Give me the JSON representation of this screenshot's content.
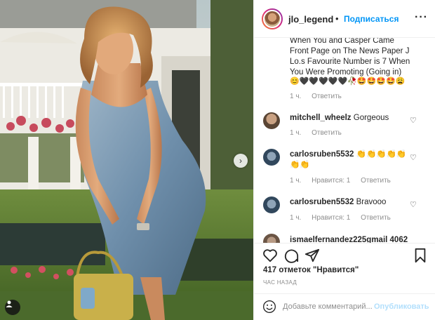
{
  "header": {
    "username": "jlo_legend",
    "separator": "•",
    "follow_label": "Подписаться",
    "more_icon": "ellipsis-icon"
  },
  "comments": {
    "first": {
      "lines": [
        "When You and Casper Came",
        "Front Page on The News Paper J",
        "Lo.s Favourite Number is 7 When",
        "You Were Promoting (Going in)"
      ],
      "emojis": "😊🖤🖤🖤🖤🖤🥀🤩🤩🤩🤩😩",
      "time": "1 ч.",
      "reply": "Ответить"
    },
    "items": [
      {
        "user": "mitchell_wheelz",
        "text": "Gorgeous",
        "time": "1 ч.",
        "likes": "",
        "reply": "Ответить"
      },
      {
        "user": "carlosruben5532",
        "text": "👏👏👏👏👏",
        "text2": "👏👏",
        "time": "1 ч.",
        "likes": "Нравится: 1",
        "reply": "Ответить"
      },
      {
        "user": "carlosruben5532",
        "text": "Bravooo",
        "time": "1 ч.",
        "likes": "Нравится: 1",
        "reply": "Ответить"
      },
      {
        "user": "ismaelfernandez225gmail 4062"
      }
    ]
  },
  "actions": {
    "likes": "417 отметок \"Нравится\"",
    "time": "ЧАС НАЗАД"
  },
  "add_comment": {
    "placeholder": "Добавьте комментарий...",
    "publish_label": "Опубликовать"
  },
  "colors": {
    "accent": "#0095f6",
    "publish_disabled": "#b2dffc",
    "muted": "#8e8e8e"
  }
}
